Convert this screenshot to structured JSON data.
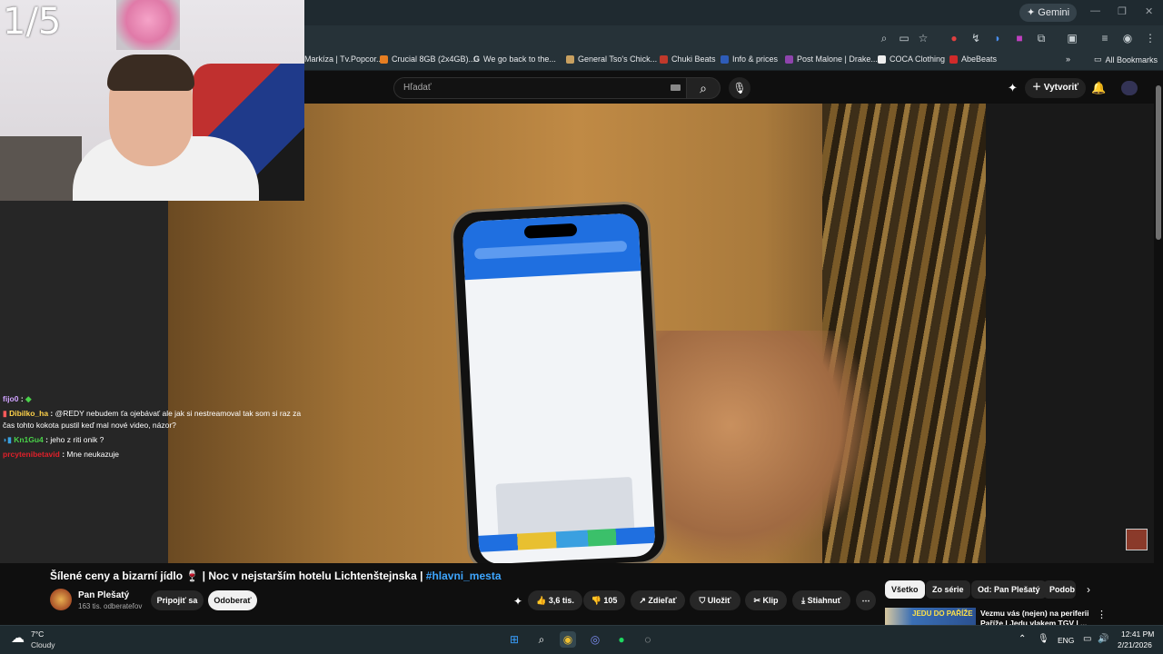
{
  "browser": {
    "gemini_label": "Gemini",
    "bookmarks": [
      {
        "label": "Markíza | Tv.Popcor...",
        "color": "#c0392b"
      },
      {
        "label": "Crucial 8GB (2x4GB)...",
        "color": "#e67e22"
      },
      {
        "label": "We go back to the...",
        "color": "#ffffff"
      },
      {
        "label": "General Tso's Chick...",
        "color": "#c8a060"
      },
      {
        "label": "Chuki Beats",
        "color": "#c0392b"
      },
      {
        "label": "Info & prices",
        "color": "#2e5cb8"
      },
      {
        "label": "Post Malone | Drake...",
        "color": "#8e44ad"
      },
      {
        "label": "COCA Clothing",
        "color": "#111111"
      },
      {
        "label": "AbeBeats",
        "color": "#d02a2a"
      }
    ],
    "all_bookmarks_label": "All Bookmarks"
  },
  "youtube": {
    "search_placeholder": "Hľadať",
    "create_label": "Vytvoriť",
    "video": {
      "title_main": "Šílené ceny a bizarní jídlo 🍷 | Noc v nejstarším hotelu Lichtenštejnska | ",
      "hashtag": "#hlavni_mesta"
    },
    "channel": {
      "name": "Pan Plešatý",
      "subscribers": "163 tis. odberateľov",
      "join_label": "Pripojiť sa",
      "subscribe_label": "Odoberať"
    },
    "actions": {
      "likes": "3,6 tis.",
      "dislikes": "105",
      "share": "Zdieľať",
      "save": "Uložiť",
      "clip": "Klip",
      "download": "Stiahnuť"
    },
    "chips": [
      "Všetko",
      "Zo série",
      "Od: Pan Plešatý",
      "Podob"
    ],
    "recommendation": {
      "thumb_text": "JEDU DO PAŘÍŽE",
      "title": "Vezmu vás (nejen) na periferii Paříže | Jedu vlakem TGV | ..."
    }
  },
  "stream": {
    "counter": "1/5",
    "chat": [
      {
        "user": "fijo0",
        "user_color": "#cfa2ff",
        "text": ""
      },
      {
        "user": "Dibilko_ha",
        "user_color": "#ffd24a",
        "text": "@REDY nebudem ťa ojebávať ale jak si nestreamoval tak som si raz za čas tohto kokota pustil keď mal nové video, názor?"
      },
      {
        "user": "Kn1Gu4",
        "user_color": "#4ad14a",
        "text": "jeho z riti onik ?"
      },
      {
        "user": "prcytenibetavid",
        "user_color": "#e0202a",
        "text": "Mne neukazuje"
      }
    ]
  },
  "taskbar": {
    "weather_temp": "7°C",
    "weather_desc": "Cloudy",
    "language": "ENG",
    "time": "12:41 PM",
    "date": "2/21/2026"
  }
}
